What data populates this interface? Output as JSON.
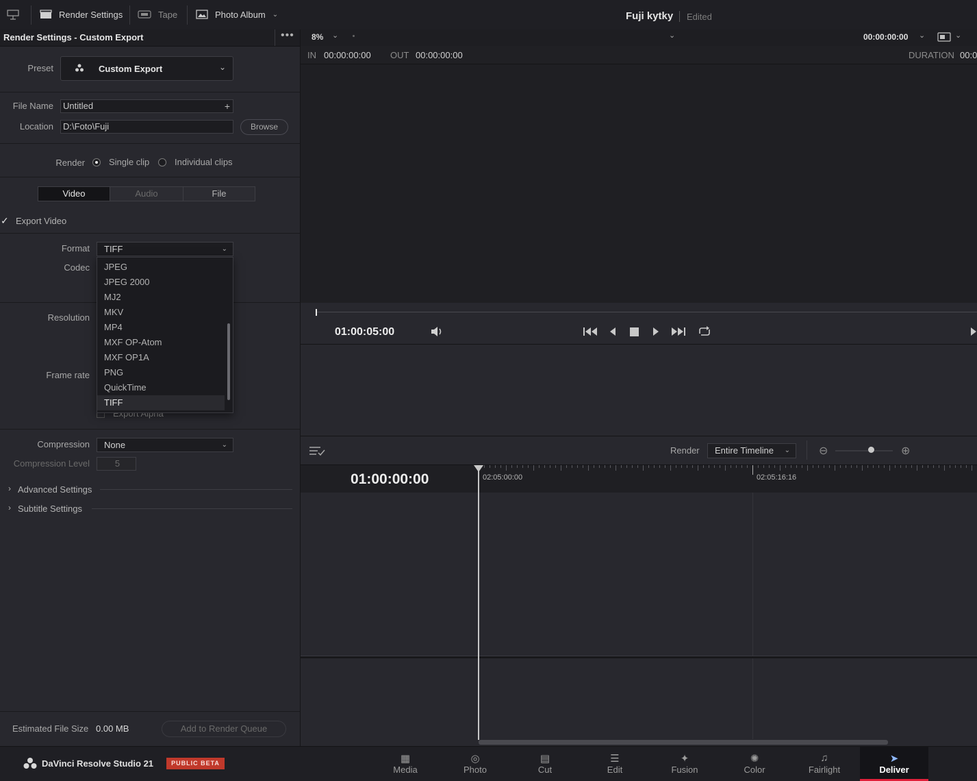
{
  "topbar": {
    "tabs": [
      {
        "label": "Render Settings"
      },
      {
        "label": "Tape"
      },
      {
        "label": "Photo Album"
      }
    ],
    "project_title": "Fuji kytky",
    "project_status": "Edited"
  },
  "panel": {
    "title": "Render Settings - Custom Export",
    "preset_label": "Preset",
    "preset_value": "Custom Export",
    "file_name_label": "File Name",
    "file_name_value": "Untitled",
    "location_label": "Location",
    "location_value": "D:\\Foto\\Fuji",
    "browse_label": "Browse",
    "render_label": "Render",
    "render_single": "Single clip",
    "render_individual": "Individual clips",
    "tabs": [
      "Video",
      "Audio",
      "File"
    ],
    "export_video_label": "Export Video",
    "format_label": "Format",
    "format_value": "TIFF",
    "codec_label": "Codec",
    "resolution_label": "Resolution",
    "frame_rate_label": "Frame rate",
    "export_alpha_label": "Export Alpha",
    "compression_label": "Compression",
    "compression_value": "None",
    "compression_level_label": "Compression Level",
    "compression_level_value": "5",
    "advanced_label": "Advanced Settings",
    "subtitle_label": "Subtitle Settings",
    "est_size_label": "Estimated File Size",
    "est_size_value": "0.00 MB",
    "add_queue_label": "Add to Render Queue"
  },
  "format_options": [
    "JPEG",
    "JPEG 2000",
    "MJ2",
    "MKV",
    "MP4",
    "MXF OP-Atom",
    "MXF OP1A",
    "PNG",
    "QuickTime",
    "TIFF"
  ],
  "format_selected": "TIFF",
  "viewer": {
    "zoom": "8%",
    "timecode_top": "00:00:00:00",
    "in_label": "IN",
    "in_value": "00:00:00:00",
    "out_label": "OUT",
    "out_value": "00:00:00:00",
    "duration_label": "DURATION",
    "duration_value": "00:0",
    "current_timecode": "01:00:05:00"
  },
  "timeline": {
    "render_label": "Render",
    "render_value": "Entire Timeline",
    "timecode": "01:00:00:00",
    "ruler_marks": [
      "02:05:00:00",
      "02:05:16:16"
    ]
  },
  "bottombar": {
    "app_name": "DaVinci Resolve Studio 21",
    "badge": "PUBLIC BETA",
    "pages": [
      {
        "label": "Media",
        "icon": "media-icon"
      },
      {
        "label": "Photo",
        "icon": "photo-icon"
      },
      {
        "label": "Cut",
        "icon": "cut-icon"
      },
      {
        "label": "Edit",
        "icon": "edit-icon"
      },
      {
        "label": "Fusion",
        "icon": "fusion-icon"
      },
      {
        "label": "Color",
        "icon": "color-icon"
      },
      {
        "label": "Fairlight",
        "icon": "fairlight-icon"
      },
      {
        "label": "Deliver",
        "icon": "deliver-icon"
      }
    ],
    "active_page": "Deliver",
    "badge_color": "#c0392b",
    "accent_color": "#e0203a"
  }
}
